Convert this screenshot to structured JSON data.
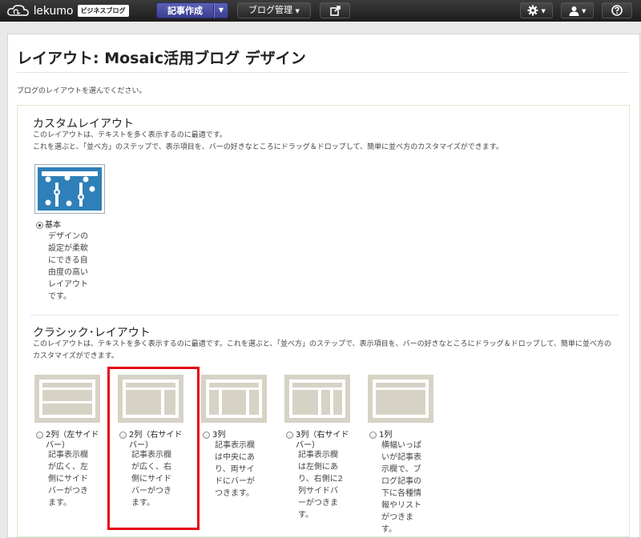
{
  "header": {
    "logo_text": "lekumo",
    "logo_badge": "ビジネスブログ",
    "write_button": "記事作成",
    "blog_menu": "ブログ管理",
    "icons": [
      "cloud-logo-icon",
      "external-link-icon",
      "gear-icon",
      "user-icon",
      "help-icon"
    ]
  },
  "page": {
    "title": "レイアウト: Mosaic活用ブログ デザイン",
    "intro": "ブログのレイアウトを選んでください。"
  },
  "custom_section": {
    "title": "カスタムレイアウト",
    "desc_line1": "このレイアウトは、テキストを多く表示するのに最適です。",
    "desc_line2": "これを選ぶと、「並べ方」のステップで、表示項目を、バーの好きなところにドラッグ＆ドロップして、簡単に並べ方のカスタマイズができます。",
    "option": {
      "label": "基本",
      "desc": "デザインの設定が柔軟にできる自由度の高いレイアウトです。",
      "checked": true
    }
  },
  "classic_section": {
    "title": "クラシック･レイアウト",
    "desc": "このレイアウトは、テキストを多く表示するのに最適です。これを選ぶと、「並べ方」のステップで、表示項目を、バーの好きなところにドラッグ＆ドロップして、簡単に並べ方のカスタマイズができます。",
    "options": [
      {
        "label": "2列（左サイドバー）",
        "desc": "記事表示欄が広く、左側にサイドバーがつきます。",
        "checked": false
      },
      {
        "label": "2列（右サイドバー）",
        "desc": "記事表示欄が広く、右側にサイドバーがつきます。",
        "checked": false
      },
      {
        "label": "3列",
        "desc": "記事表示欄は中央にあり、両サイドにバーがつきます。",
        "checked": false
      },
      {
        "label": "3列（右サイドバー）",
        "desc": "記事表示欄は左側にあり、右側に2列サイドバーがつきます。",
        "checked": false
      },
      {
        "label": "1列",
        "desc": "横幅いっぱいが記事表示欄で、ブログ記事の下に各種情報やリストがつきます。",
        "checked": false
      }
    ]
  },
  "colors": {
    "accent_button": "#393e8f",
    "highlight": "#e60012",
    "thumb_bg": "#d6d3c6",
    "custom_thumb": "#2f7fb8"
  }
}
